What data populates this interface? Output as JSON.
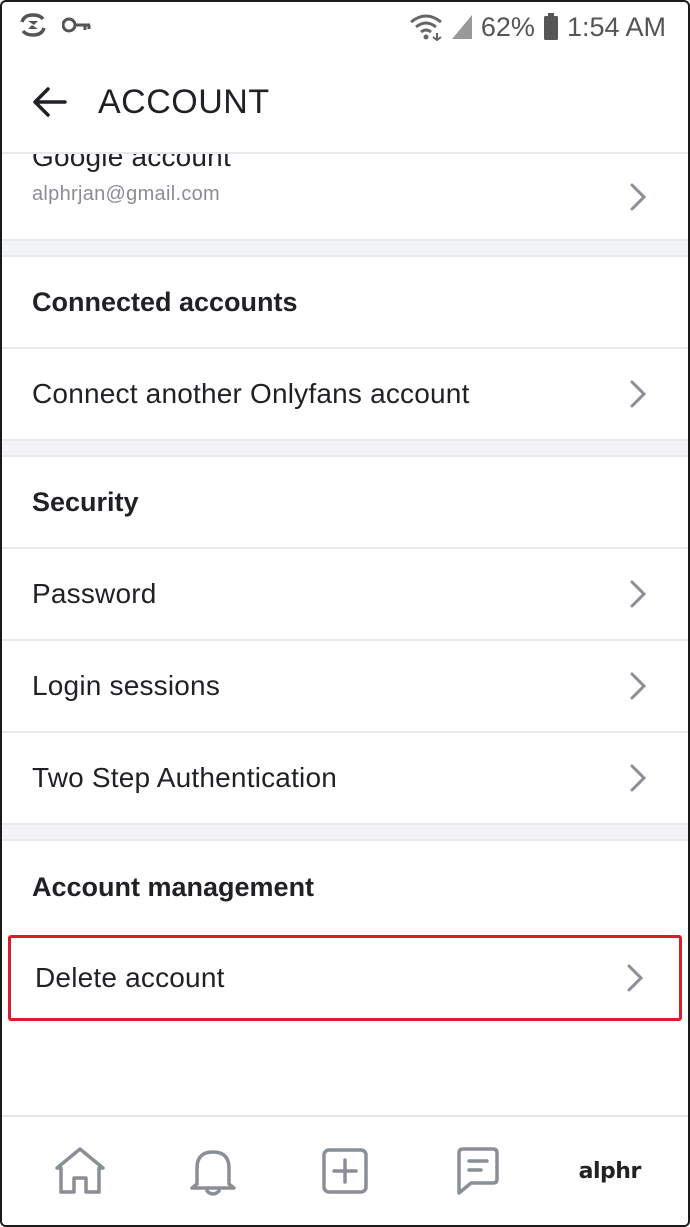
{
  "status_bar": {
    "battery_percent": "62%",
    "time": "1:54 AM",
    "icons": [
      "sync-icon",
      "key-icon",
      "wifi-icon",
      "signal-icon",
      "battery-icon"
    ]
  },
  "header": {
    "back_icon": "arrow-left-icon",
    "title": "ACCOUNT"
  },
  "google": {
    "label": "Google account",
    "email": "alphrjan@gmail.com"
  },
  "sections": {
    "connected": {
      "title": "Connected accounts",
      "items": [
        "Connect another Onlyfans account"
      ]
    },
    "security": {
      "title": "Security",
      "items": [
        "Password",
        "Login sessions",
        "Two Step Authentication"
      ]
    },
    "management": {
      "title": "Account management",
      "items": [
        "Delete account"
      ]
    }
  },
  "highlight_color": "#d81e2c",
  "bottom_nav": {
    "items": [
      "home-icon",
      "bell-icon",
      "add-post-icon",
      "messages-icon"
    ],
    "brand": "alphr"
  }
}
